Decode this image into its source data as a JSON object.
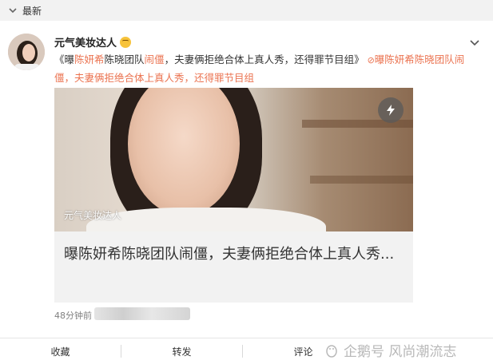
{
  "topbar": {
    "label": "最新"
  },
  "post": {
    "author": "元气美妆达人",
    "text_parts": [
      {
        "t": "《曝",
        "c": "n"
      },
      {
        "t": "陈妍希",
        "c": "h"
      },
      {
        "t": "陈晓团队",
        "c": "n"
      },
      {
        "t": "闹僵",
        "c": "h"
      },
      {
        "t": "，夫妻俩拒绝合体上真人秀，还得罪节目组》",
        "c": "n"
      }
    ],
    "link_text": "曝陈妍希陈晓团队闹僵，夫妻俩拒绝合体上真人秀，还得罪节目组",
    "media": {
      "watermark": "元气美妆达人",
      "title": "曝陈妍希陈晓团队闹僵，夫妻俩拒绝合体上真人秀..."
    },
    "time": "48分钟前"
  },
  "actions": {
    "collect": "收藏",
    "repost": "转发",
    "comment": "评论"
  },
  "watermark_overlay": "企鹅号 风尚潮流志"
}
